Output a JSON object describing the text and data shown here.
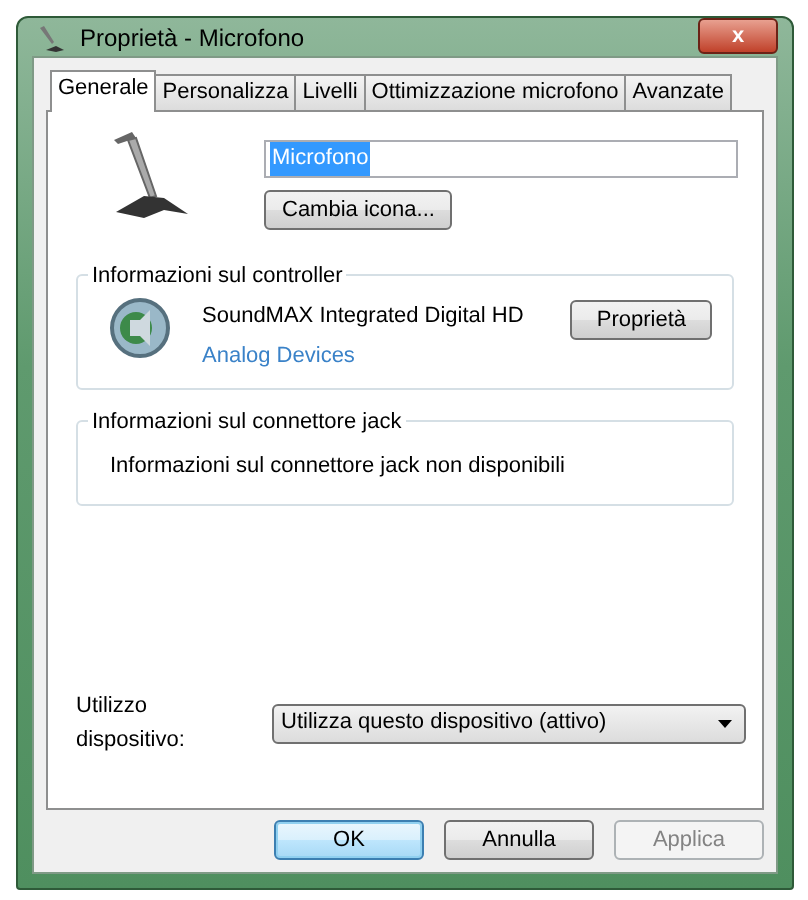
{
  "window": {
    "title": "Proprietà - Microfono",
    "close": "x"
  },
  "tabs": [
    {
      "label": "Generale",
      "selected": true
    },
    {
      "label": "Personalizza",
      "selected": false
    },
    {
      "label": "Livelli",
      "selected": false
    },
    {
      "label": "Ottimizzazione microfono",
      "selected": false
    },
    {
      "label": "Avanzate",
      "selected": false
    }
  ],
  "device": {
    "name_value": "Microfono",
    "change_icon_button": "Cambia icona..."
  },
  "controller": {
    "title": "Informazioni sul controller",
    "name": "SoundMAX Integrated Digital HD",
    "vendor_link": "Analog Devices",
    "properties_button": "Proprietà"
  },
  "jack": {
    "title": "Informazioni sul connettore jack",
    "message": "Informazioni sul connettore jack non disponibili"
  },
  "usage": {
    "label": "Utilizzo dispositivo:",
    "value": "Utilizza questo dispositivo (attivo)"
  },
  "buttons": [
    {
      "label": "OK",
      "default": true,
      "disabled": false
    },
    {
      "label": "Annulla",
      "default": false,
      "disabled": false
    },
    {
      "label": "Applica",
      "default": false,
      "disabled": true
    }
  ]
}
